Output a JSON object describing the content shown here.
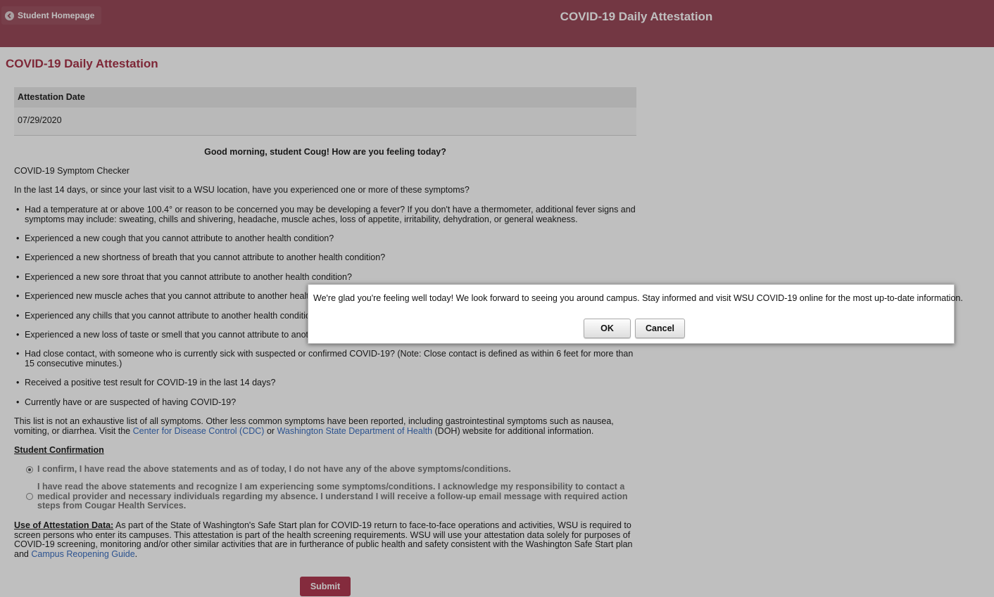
{
  "header": {
    "back_label": "Student Homepage",
    "back_icon": "chevron-left-icon",
    "title": "COVID-19 Daily Attestation"
  },
  "page": {
    "title": "COVID-19 Daily Attestation",
    "date_header": "Attestation Date",
    "date_value": "07/29/2020",
    "greeting": "Good morning, student Coug! How are you feeling today?",
    "checker_title": "COVID-19 Symptom Checker",
    "question": "In the last 14 days, or since your last visit to a WSU location, have you experienced one or more of these symptoms?",
    "symptoms": [
      "Had a temperature at or above 100.4° or reason to be concerned you may be developing a fever? If you don't have a thermometer, additional fever signs and symptoms may include: sweating, chills and shivering, headache, muscle aches, loss of appetite, irritability, dehydration, or general weakness.",
      "Experienced a new cough that you cannot attribute to another health condition?",
      "Experienced a new shortness of breath that you cannot attribute to another health condition?",
      "Experienced a new sore throat that you cannot attribute to another health condition?",
      "Experienced new muscle aches that you cannot attribute to another health condition?",
      "Experienced any chills that you cannot attribute to another health condition?",
      "Experienced a new loss of taste or smell that you cannot attribute to another health condition?",
      "Had close contact, with someone who is currently sick with suspected or confirmed COVID-19? (Note: Close contact is defined as within 6 feet for more than 15 consecutive minutes.)",
      "Received a positive test result for COVID-19 in the last 14 days?",
      "Currently have or are suspected of having COVID-19?"
    ],
    "disclaimer_pre": "This list is not an exhaustive list of all symptoms. Other less common symptoms have been reported, including gastrointestinal symptoms such as nausea, vomiting, or diarrhea. Visit the ",
    "cdc_link": "Center for Disease Control (CDC)",
    "disclaimer_or": " or ",
    "doh_link": "Washington State Department of Health",
    "disclaimer_post": " (DOH) website for additional information.",
    "confirmation_heading": "Student Confirmation",
    "option_well": "I confirm, I have read the above statements and as of today, I do not have any of the above symptoms/conditions.",
    "option_sick": "I have read the above statements and recognize I am experiencing some symptoms/conditions. I acknowledge my responsibility to contact a medical provider and necessary individuals regarding my absence. I understand I will receive a follow-up email message with required action steps from Cougar Health Services.",
    "selected_option": "option_well",
    "use_heading": "Use of Attestation Data:",
    "use_text": " As part of the State of Washington's Safe Start plan for COVID-19 return to face-to-face operations and activities, WSU is required to screen persons who enter its campuses. This attestation is part of the health screening requirements. WSU will use your attestation data solely for purposes of COVID-19 screening, monitoring and/or other similar activities that are in furtherance of public health and safety consistent with the Washington Safe Start plan and ",
    "guide_link": "Campus Reopening Guide",
    "use_end": ".",
    "submit_label": "Submit"
  },
  "dialog": {
    "message": "We're glad you're feeling well today! We look forward to seeing you around campus. Stay informed and visit WSU COVID-19 online for the most up-to-date information.",
    "ok_label": "OK",
    "cancel_label": "Cancel"
  },
  "colors": {
    "header_bg": "#9a4a5a",
    "title_accent": "#a8354a",
    "link": "#3b6fc0",
    "submit_bg": "#b03a52"
  }
}
